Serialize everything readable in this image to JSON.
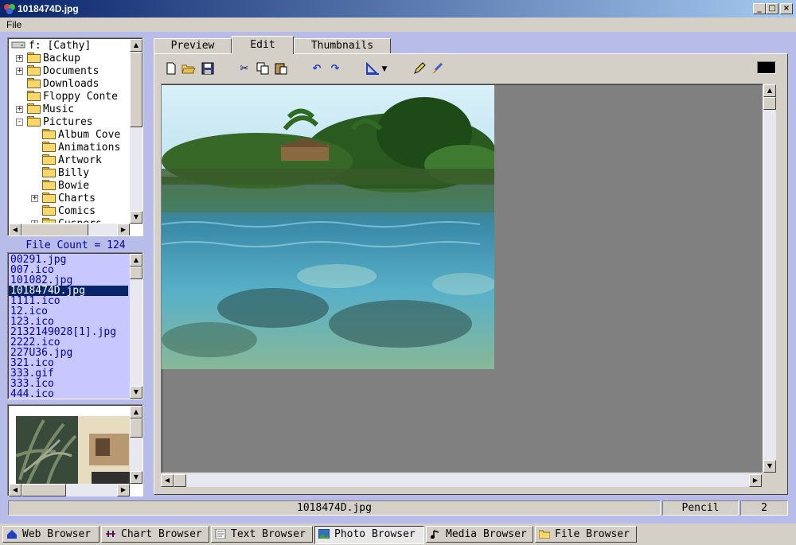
{
  "window": {
    "title": "1018474D.jpg",
    "min": "_",
    "max": "□",
    "close": "×"
  },
  "menu": {
    "file": "File"
  },
  "tree": {
    "root": "f: [Cathy]",
    "items": [
      {
        "label": "Backup",
        "expander": "+"
      },
      {
        "label": "Documents",
        "expander": "+"
      },
      {
        "label": "Downloads",
        "expander": ""
      },
      {
        "label": "Floppy Conte",
        "expander": ""
      },
      {
        "label": "Music",
        "expander": "+"
      },
      {
        "label": "Pictures",
        "expander": "-"
      },
      {
        "label": "Album Cove",
        "expander": ""
      },
      {
        "label": "Animations",
        "expander": ""
      },
      {
        "label": "Artwork",
        "expander": ""
      },
      {
        "label": "Billy",
        "expander": ""
      },
      {
        "label": "Bowie",
        "expander": ""
      },
      {
        "label": "Charts",
        "expander": "+"
      },
      {
        "label": "Comics",
        "expander": ""
      },
      {
        "label": "Cuspers",
        "expander": "+"
      }
    ]
  },
  "file_count": "File Count = 124",
  "files": [
    "00291.jpg",
    "007.ico",
    "101082.jpg",
    "1018474D.jpg",
    "1111.ico",
    "12.ico",
    "123.ico",
    "2132149028[1].jpg",
    "2222.ico",
    "227U36.jpg",
    "321.ico",
    "333.gif",
    "333.ico",
    "444.ico"
  ],
  "selected_file": "1018474D.jpg",
  "tabs": [
    {
      "label": "Preview"
    },
    {
      "label": "Edit"
    },
    {
      "label": "Thumbnails"
    }
  ],
  "active_tab": "Edit",
  "toolbar": {
    "new": "🗋",
    "open": "📂",
    "save": "💾",
    "cut": "✂",
    "copy": "⎘",
    "paste": "📋",
    "undo": "↶",
    "redo": "↷",
    "tool_select": "📐",
    "dropdown": "▾",
    "pencil": "✎",
    "brush": "🖌"
  },
  "color_swatch": "#000000",
  "status": {
    "filename": "1018474D.jpg",
    "tool": "Pencil",
    "value": "2"
  },
  "taskbar": [
    {
      "label": "Web Browser",
      "icon": "home-icon"
    },
    {
      "label": "Chart Browser",
      "icon": "chart-icon"
    },
    {
      "label": "Text Browser",
      "icon": "text-icon"
    },
    {
      "label": "Photo Browser",
      "icon": "photo-icon"
    },
    {
      "label": "Media Browser",
      "icon": "music-icon"
    },
    {
      "label": "File Browser",
      "icon": "folder-icon"
    }
  ],
  "active_task": "Photo Browser",
  "colors": {
    "accent": "#0a246a",
    "panel": "#b8bce8",
    "list": "#c8c8ff",
    "canvas": "#808080"
  }
}
